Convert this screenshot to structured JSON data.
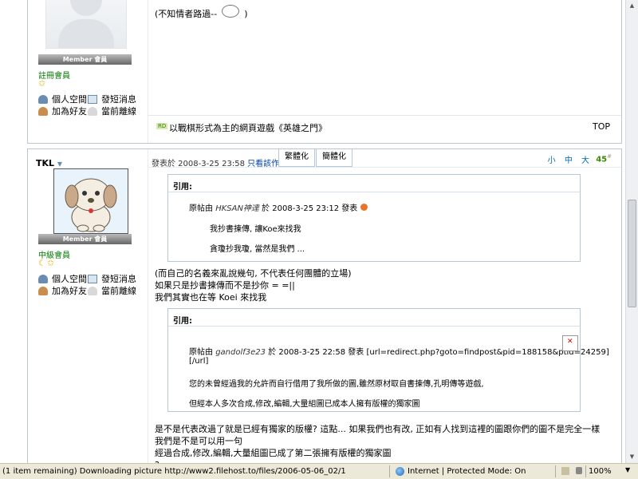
{
  "post1": {
    "member_badge": "Member 會員",
    "rank": "註冊會員",
    "stars": "✩",
    "links": {
      "space": "個人空間",
      "pm": "發短消息",
      "add_friend": "加為好友",
      "status": "當前離線"
    },
    "text": "(不知情者路過--",
    "text_end": ")",
    "signature": "以戰棋形式為主的網頁遊戲《英雄之門》",
    "rd_badge": "RD",
    "top_link": "TOP"
  },
  "post2": {
    "username": "TKL",
    "member_badge": "Member 會員",
    "rank": "中級會員",
    "stars": "☾✩",
    "links": {
      "space": "個人空間",
      "pm": "發短消息",
      "add_friend": "加為好友",
      "status": "當前離線"
    },
    "meta": "發表於 2008-3-25 23:58",
    "only_author": "只看該作者",
    "tab_traditional": "繁體化",
    "tab_simplified": "簡體化",
    "font_sizes": "小 中 大",
    "post_number": "45",
    "post_number_sup": "#",
    "quote1": {
      "title": "引用:",
      "header_prefix": "原帖由",
      "author": "HKSAN神達",
      "header_suffix": "於 2008-3-25 23:12 發表",
      "line1": "我抄書揀傳, 讓Koe來找我",
      "line2": "貪瓊抄我瓊, 當然是我們 ..."
    },
    "body1": [
      "(而自己的名義來亂說幾句, 不代表任何團體的立場)",
      "如果只是抄書揀傳而不是抄你 = =||",
      "我們其實也在等 Koei 來找我"
    ],
    "quote2": {
      "title": "引用:",
      "header_prefix": "原帖由",
      "author": "gandolf3e23",
      "header_suffix": "於 2008-3-25 22:58 發表 [url=redirect.php?goto=findpost&pid=188158&ptid=24259]",
      "header_line2": "[/url]",
      "line1": "您的未曾經過我的允許而自行借用了我所做的圖,雖然原材取自書揀傳,孔明傳等遊戲,",
      "line2": "但經本人多次合成,修改,編輯,大量組圖已成本人擁有版權的獨家圖"
    },
    "body2": [
      "是不是代表改過了就是已經有獨家的版權? 這點... 如果我們也有改, 正如有人找到這裡的圖跟你們的圖不是完全一樣",
      "我們是不是可以用一句",
      "經過合成,修改,編輯,大量組圖已成了第二張擁有版權的獨家圖",
      "?"
    ]
  },
  "statusbar": {
    "text": "(1 item remaining) Downloading picture http://www2.filehost.to/files/2006-05-06_02/1",
    "zone": "Internet | Protected Mode: On",
    "zoom": "100%",
    "zoom_arrow": "▼"
  }
}
